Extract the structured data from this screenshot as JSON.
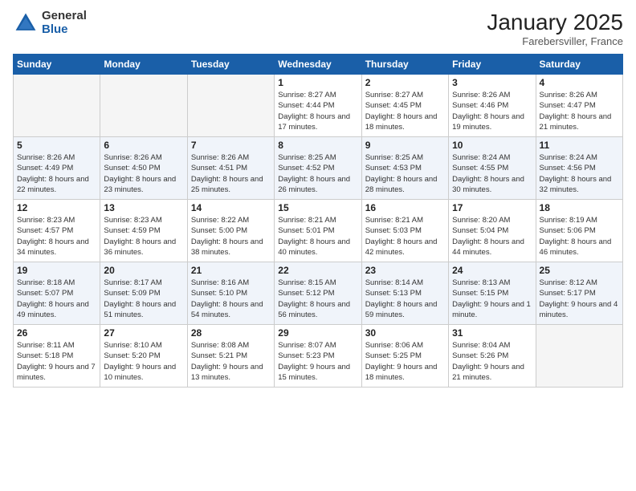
{
  "header": {
    "logo": {
      "general": "General",
      "blue": "Blue"
    },
    "title": "January 2025",
    "subtitle": "Farebersviller, France"
  },
  "calendar": {
    "days_of_week": [
      "Sunday",
      "Monday",
      "Tuesday",
      "Wednesday",
      "Thursday",
      "Friday",
      "Saturday"
    ],
    "weeks": [
      {
        "alt": false,
        "days": [
          {
            "num": "",
            "empty": true
          },
          {
            "num": "",
            "empty": true
          },
          {
            "num": "",
            "empty": true
          },
          {
            "num": "1",
            "sunrise": "Sunrise: 8:27 AM",
            "sunset": "Sunset: 4:44 PM",
            "daylight": "Daylight: 8 hours and 17 minutes."
          },
          {
            "num": "2",
            "sunrise": "Sunrise: 8:27 AM",
            "sunset": "Sunset: 4:45 PM",
            "daylight": "Daylight: 8 hours and 18 minutes."
          },
          {
            "num": "3",
            "sunrise": "Sunrise: 8:26 AM",
            "sunset": "Sunset: 4:46 PM",
            "daylight": "Daylight: 8 hours and 19 minutes."
          },
          {
            "num": "4",
            "sunrise": "Sunrise: 8:26 AM",
            "sunset": "Sunset: 4:47 PM",
            "daylight": "Daylight: 8 hours and 21 minutes."
          }
        ]
      },
      {
        "alt": true,
        "days": [
          {
            "num": "5",
            "sunrise": "Sunrise: 8:26 AM",
            "sunset": "Sunset: 4:49 PM",
            "daylight": "Daylight: 8 hours and 22 minutes."
          },
          {
            "num": "6",
            "sunrise": "Sunrise: 8:26 AM",
            "sunset": "Sunset: 4:50 PM",
            "daylight": "Daylight: 8 hours and 23 minutes."
          },
          {
            "num": "7",
            "sunrise": "Sunrise: 8:26 AM",
            "sunset": "Sunset: 4:51 PM",
            "daylight": "Daylight: 8 hours and 25 minutes."
          },
          {
            "num": "8",
            "sunrise": "Sunrise: 8:25 AM",
            "sunset": "Sunset: 4:52 PM",
            "daylight": "Daylight: 8 hours and 26 minutes."
          },
          {
            "num": "9",
            "sunrise": "Sunrise: 8:25 AM",
            "sunset": "Sunset: 4:53 PM",
            "daylight": "Daylight: 8 hours and 28 minutes."
          },
          {
            "num": "10",
            "sunrise": "Sunrise: 8:24 AM",
            "sunset": "Sunset: 4:55 PM",
            "daylight": "Daylight: 8 hours and 30 minutes."
          },
          {
            "num": "11",
            "sunrise": "Sunrise: 8:24 AM",
            "sunset": "Sunset: 4:56 PM",
            "daylight": "Daylight: 8 hours and 32 minutes."
          }
        ]
      },
      {
        "alt": false,
        "days": [
          {
            "num": "12",
            "sunrise": "Sunrise: 8:23 AM",
            "sunset": "Sunset: 4:57 PM",
            "daylight": "Daylight: 8 hours and 34 minutes."
          },
          {
            "num": "13",
            "sunrise": "Sunrise: 8:23 AM",
            "sunset": "Sunset: 4:59 PM",
            "daylight": "Daylight: 8 hours and 36 minutes."
          },
          {
            "num": "14",
            "sunrise": "Sunrise: 8:22 AM",
            "sunset": "Sunset: 5:00 PM",
            "daylight": "Daylight: 8 hours and 38 minutes."
          },
          {
            "num": "15",
            "sunrise": "Sunrise: 8:21 AM",
            "sunset": "Sunset: 5:01 PM",
            "daylight": "Daylight: 8 hours and 40 minutes."
          },
          {
            "num": "16",
            "sunrise": "Sunrise: 8:21 AM",
            "sunset": "Sunset: 5:03 PM",
            "daylight": "Daylight: 8 hours and 42 minutes."
          },
          {
            "num": "17",
            "sunrise": "Sunrise: 8:20 AM",
            "sunset": "Sunset: 5:04 PM",
            "daylight": "Daylight: 8 hours and 44 minutes."
          },
          {
            "num": "18",
            "sunrise": "Sunrise: 8:19 AM",
            "sunset": "Sunset: 5:06 PM",
            "daylight": "Daylight: 8 hours and 46 minutes."
          }
        ]
      },
      {
        "alt": true,
        "days": [
          {
            "num": "19",
            "sunrise": "Sunrise: 8:18 AM",
            "sunset": "Sunset: 5:07 PM",
            "daylight": "Daylight: 8 hours and 49 minutes."
          },
          {
            "num": "20",
            "sunrise": "Sunrise: 8:17 AM",
            "sunset": "Sunset: 5:09 PM",
            "daylight": "Daylight: 8 hours and 51 minutes."
          },
          {
            "num": "21",
            "sunrise": "Sunrise: 8:16 AM",
            "sunset": "Sunset: 5:10 PM",
            "daylight": "Daylight: 8 hours and 54 minutes."
          },
          {
            "num": "22",
            "sunrise": "Sunrise: 8:15 AM",
            "sunset": "Sunset: 5:12 PM",
            "daylight": "Daylight: 8 hours and 56 minutes."
          },
          {
            "num": "23",
            "sunrise": "Sunrise: 8:14 AM",
            "sunset": "Sunset: 5:13 PM",
            "daylight": "Daylight: 8 hours and 59 minutes."
          },
          {
            "num": "24",
            "sunrise": "Sunrise: 8:13 AM",
            "sunset": "Sunset: 5:15 PM",
            "daylight": "Daylight: 9 hours and 1 minute."
          },
          {
            "num": "25",
            "sunrise": "Sunrise: 8:12 AM",
            "sunset": "Sunset: 5:17 PM",
            "daylight": "Daylight: 9 hours and 4 minutes."
          }
        ]
      },
      {
        "alt": false,
        "days": [
          {
            "num": "26",
            "sunrise": "Sunrise: 8:11 AM",
            "sunset": "Sunset: 5:18 PM",
            "daylight": "Daylight: 9 hours and 7 minutes."
          },
          {
            "num": "27",
            "sunrise": "Sunrise: 8:10 AM",
            "sunset": "Sunset: 5:20 PM",
            "daylight": "Daylight: 9 hours and 10 minutes."
          },
          {
            "num": "28",
            "sunrise": "Sunrise: 8:08 AM",
            "sunset": "Sunset: 5:21 PM",
            "daylight": "Daylight: 9 hours and 13 minutes."
          },
          {
            "num": "29",
            "sunrise": "Sunrise: 8:07 AM",
            "sunset": "Sunset: 5:23 PM",
            "daylight": "Daylight: 9 hours and 15 minutes."
          },
          {
            "num": "30",
            "sunrise": "Sunrise: 8:06 AM",
            "sunset": "Sunset: 5:25 PM",
            "daylight": "Daylight: 9 hours and 18 minutes."
          },
          {
            "num": "31",
            "sunrise": "Sunrise: 8:04 AM",
            "sunset": "Sunset: 5:26 PM",
            "daylight": "Daylight: 9 hours and 21 minutes."
          },
          {
            "num": "",
            "empty": true
          }
        ]
      }
    ]
  }
}
